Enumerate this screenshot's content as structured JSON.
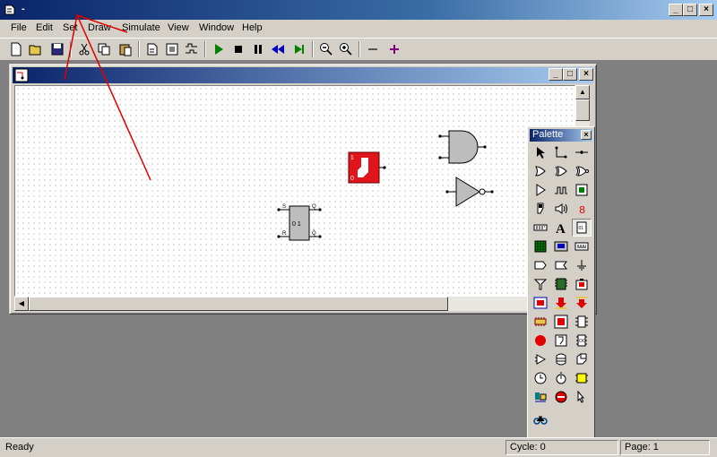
{
  "window": {
    "title": "-",
    "minimize": "_",
    "maximize": "□",
    "close": "×"
  },
  "menu": [
    "File",
    "Edit",
    "Set",
    "Draw",
    "Simulate",
    "View",
    "Window",
    "Help"
  ],
  "toolbar_icons": [
    "new-file-icon",
    "open-folder-icon",
    "save-icon",
    "cut-icon",
    "copy-icon",
    "paste-icon",
    "print-icon",
    "properties-icon",
    "waveform-icon",
    "run-icon",
    "stop-icon",
    "pause-icon",
    "rewind-icon",
    "step-icon",
    "zoom-out-icon",
    "zoom-in-icon",
    "minus-icon",
    "plus-icon"
  ],
  "child_window": {
    "title": ""
  },
  "components": {
    "and_gate": "and-gate-icon",
    "inverter": "inverter-icon",
    "switch": {
      "label_top": "1",
      "label_bottom": "0"
    },
    "flipflop": {
      "label": "0 1",
      "pin_s": "S",
      "pin_r": "R",
      "pin_q": "Q",
      "pin_qbar": "Q̄"
    }
  },
  "palette": {
    "title": "Palette",
    "close": "×",
    "icons": [
      "pointer-icon",
      "wire-icon",
      "junction-icon",
      "or-gate-icon",
      "xor-gate-icon",
      "xnor-gate-icon",
      "buffer-icon",
      "clock-icon",
      "led-icon",
      "switch-icon",
      "speaker-icon",
      "seven-segment-icon",
      "keypad-icon",
      "text-icon",
      "register-icon",
      "matrix-icon",
      "display-icon",
      "counter-icon",
      "bus-icon",
      "tristate-icon",
      "ground-icon",
      "filter-icon",
      "chip-icon",
      "probe-icon",
      "memory-icon",
      "input-arrow-icon",
      "output-arrow-icon",
      "ic-icon",
      "stop-sign-icon",
      "decoder-icon",
      "dip-icon",
      "amplifier-icon",
      "bell-icon",
      "cube-icon",
      "timer-icon",
      "stopwatch-icon",
      "power-icon",
      "connector-icon",
      "meter-icon",
      "cursor-icon",
      "transistor-icon",
      "pen-icon",
      "bicycle-icon"
    ]
  },
  "status": {
    "text": "Ready",
    "cycle": "Cycle: 0",
    "page": "Page: 1"
  },
  "colors": {
    "titlebar": "#0a246a",
    "switch_red": "#e0141b",
    "annotation": "#e00000"
  }
}
